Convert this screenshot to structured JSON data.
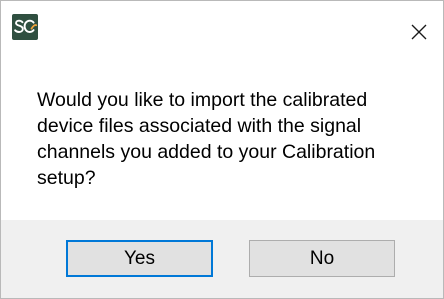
{
  "dialog": {
    "icon": "sc-app-icon",
    "close_icon": "close-icon",
    "message": "Would you like to import the calibrated device files associated with the signal channels you added to your Calibration setup?",
    "buttons": {
      "yes_label": "Yes",
      "no_label": "No",
      "default": "Yes"
    },
    "colors": {
      "icon_background": "#2f4f40",
      "focus_border": "#0078d7",
      "footer_background": "#f0f0f0"
    }
  }
}
